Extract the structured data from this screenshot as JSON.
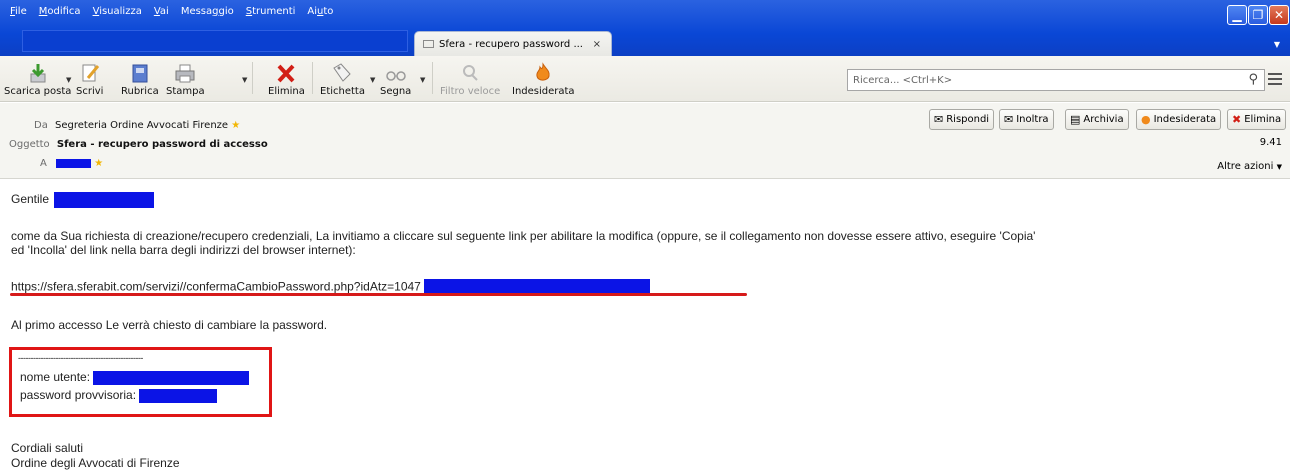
{
  "menu": {
    "items": [
      "File",
      "Modifica",
      "Visualizza",
      "Vai",
      "Messaggio",
      "Strumenti",
      "Aiuto"
    ],
    "underline_letters": [
      "F",
      "M",
      "V",
      "V",
      "g",
      "S",
      "u"
    ]
  },
  "tab": {
    "title": "Sfera - recupero password ...",
    "close": "×"
  },
  "window": {
    "minimize": "▁",
    "maximize": "❐",
    "close": "✕"
  },
  "toolbar": {
    "get_mail": "Scarica posta",
    "write": "Scrivi",
    "address_book": "Rubrica",
    "print": "Stampa",
    "delete": "Elimina",
    "tag": "Etichetta",
    "mark": "Segna",
    "quick_filter": "Filtro veloce",
    "junk": "Indesiderata"
  },
  "search": {
    "placeholder": "Ricerca... <Ctrl+K>"
  },
  "header": {
    "from_label": "Da",
    "from_value": "Segreteria Ordine Avvocati Firenze",
    "subject_label": "Oggetto",
    "subject_value": "Sfera - recupero password di accesso",
    "to_label": "A",
    "time": "9.41",
    "more_actions": "Altre azioni",
    "buttons": {
      "reply": "Rispondi",
      "forward": "Inoltra",
      "archive": "Archivia",
      "junk": "Indesiderata",
      "delete": "Elimina"
    }
  },
  "body": {
    "greeting": "Gentile",
    "paragraph_line1": "come da Sua richiesta di creazione/recupero credenziali, La invitiamo a cliccare sul seguente link per abilitare la modifica (oppure, se il collegamento non dovesse essere attivo, eseguire 'Copia'",
    "paragraph_line2": "ed 'Incolla' del link nella barra degli indirizzi del browser internet):",
    "link": "https://sfera.sferabit.com/servizi//confermaCambioPassword.php?idAtz=1047",
    "first_access": "Al primo accesso Le verrà chiesto di cambiare la password.",
    "dashes": "--------------------------------------------------",
    "username_label": "nome utente:",
    "temp_password_label": "password provvisoria:",
    "closing": "Cordiali saluti",
    "signature": "Ordine degli Avvocati di Firenze"
  },
  "colors": {
    "titlebar": "#0a47d6",
    "redaction": "#0b14e6",
    "highlight_red": "#e01515"
  }
}
